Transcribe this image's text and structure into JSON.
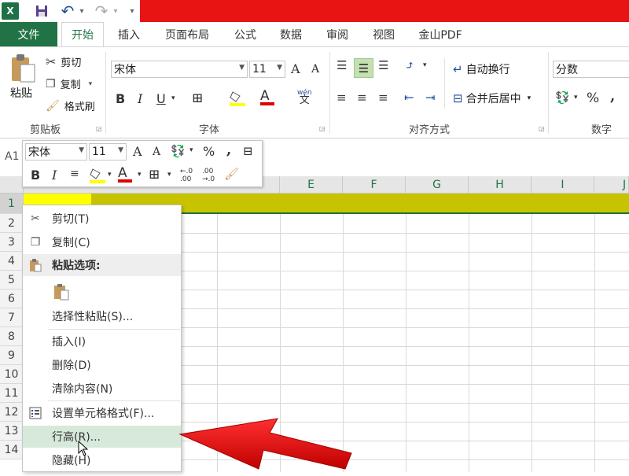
{
  "quick_access": {
    "excel_logo": "X",
    "undo_arrow": "↶",
    "redo_arrow": "↷",
    "more": "▾"
  },
  "tabs": [
    "文件",
    "开始",
    "插入",
    "页面布局",
    "公式",
    "数据",
    "审阅",
    "视图",
    "金山PDF"
  ],
  "clipboard": {
    "paste": "粘贴",
    "cut": "剪切",
    "copy": "复制",
    "format_painter": "格式刷",
    "group": "剪贴板"
  },
  "font": {
    "name": "宋体",
    "size": "11",
    "group": "字体",
    "bold": "B",
    "italic": "I",
    "underline": "U",
    "grow": "A",
    "shrink": "A",
    "wen": "wén",
    "wen_char": "文"
  },
  "alignment": {
    "wrap": "自动换行",
    "merge": "合并后居中",
    "group": "对齐方式"
  },
  "number": {
    "format": "分数",
    "percent": "%",
    "comma": ",",
    "group": "数字"
  },
  "namebox": "A1",
  "columns": [
    "E",
    "F",
    "G",
    "H",
    "I",
    "J"
  ],
  "rows": [
    "1",
    "2",
    "3",
    "4",
    "5",
    "6",
    "7",
    "8",
    "9",
    "10",
    "11",
    "12",
    "13",
    "14"
  ],
  "mini": {
    "font": "宋体",
    "size": "11",
    "percent": "%",
    "comma": ",",
    "bold": "B",
    "italic": "I",
    "grow": "A",
    "shrink": "A",
    "dec_inc": "←.0\n.00",
    "dec_dec": ".00\n→.0"
  },
  "menu": {
    "cut": "剪切(T)",
    "copy": "复制(C)",
    "paste_options": "粘贴选项:",
    "paste_special": "选择性粘贴(S)...",
    "insert": "插入(I)",
    "delete": "删除(D)",
    "clear": "清除内容(N)",
    "format_cells": "设置单元格格式(F)...",
    "row_height": "行高(R)...",
    "hide": "隐藏(H)"
  },
  "colors": {
    "excel_green": "#217346",
    "title_red": "#e81414",
    "row_highlight": "#c8c300",
    "menu_hover": "#d6e9da",
    "arrow_red": "#e00000"
  }
}
